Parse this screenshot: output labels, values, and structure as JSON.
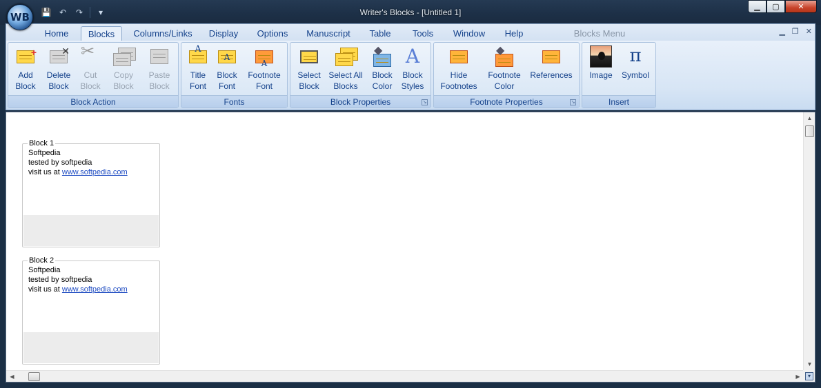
{
  "window": {
    "title": "Writer's Blocks - [Untitled 1]",
    "orb_label": "WB",
    "min_glyph": "▁",
    "max_glyph": "▢",
    "close_glyph": "✕"
  },
  "qat": {
    "save": "💾",
    "undo": "↶",
    "redo": "↷",
    "more": "▾"
  },
  "tabs": [
    {
      "label": "Home"
    },
    {
      "label": "Blocks"
    },
    {
      "label": "Columns/Links"
    },
    {
      "label": "Display"
    },
    {
      "label": "Options"
    },
    {
      "label": "Manuscript"
    },
    {
      "label": "Table"
    },
    {
      "label": "Tools"
    },
    {
      "label": "Window"
    },
    {
      "label": "Help"
    },
    {
      "label": "Blocks Menu"
    }
  ],
  "mdi": {
    "min": "▁",
    "restore": "❐",
    "close": "✕"
  },
  "groups": {
    "block_action": {
      "label": "Block Action",
      "add": {
        "l1": "Add",
        "l2": "Block"
      },
      "delete": {
        "l1": "Delete",
        "l2": "Block"
      },
      "cut": {
        "l1": "Cut",
        "l2": "Block"
      },
      "copy": {
        "l1": "Copy",
        "l2": "Block"
      },
      "paste": {
        "l1": "Paste",
        "l2": "Block"
      }
    },
    "fonts": {
      "label": "Fonts",
      "title_font": {
        "l1": "Title",
        "l2": "Font"
      },
      "block_font": {
        "l1": "Block",
        "l2": "Font"
      },
      "footnote_font": {
        "l1": "Footnote",
        "l2": "Font"
      }
    },
    "block_properties": {
      "label": "Block Properties",
      "select_block": {
        "l1": "Select",
        "l2": "Block"
      },
      "select_all": {
        "l1": "Select All",
        "l2": "Blocks"
      },
      "block_color": {
        "l1": "Block",
        "l2": "Color"
      },
      "block_styles": {
        "l1": "Block",
        "l2": "Styles"
      }
    },
    "footnote_properties": {
      "label": "Footnote Properties",
      "hide_footnotes": {
        "l1": "Hide",
        "l2": "Footnotes"
      },
      "footnote_color": {
        "l1": "Footnote",
        "l2": "Color"
      },
      "references": {
        "l1": "References"
      }
    },
    "insert": {
      "label": "Insert",
      "image": {
        "l1": "Image"
      },
      "symbol": {
        "l1": "Symbol",
        "glyph": "π"
      }
    }
  },
  "blocks": [
    {
      "title": "Block 1",
      "line1": "Softpedia",
      "line2": "tested by softpedia",
      "prefix": "visit us at",
      "link": "www.softpedia.com"
    },
    {
      "title": "Block 2",
      "line1": "Softpedia",
      "line2": "tested by softpedia",
      "prefix": "visit us at",
      "link": "www.softpedia.com"
    }
  ]
}
